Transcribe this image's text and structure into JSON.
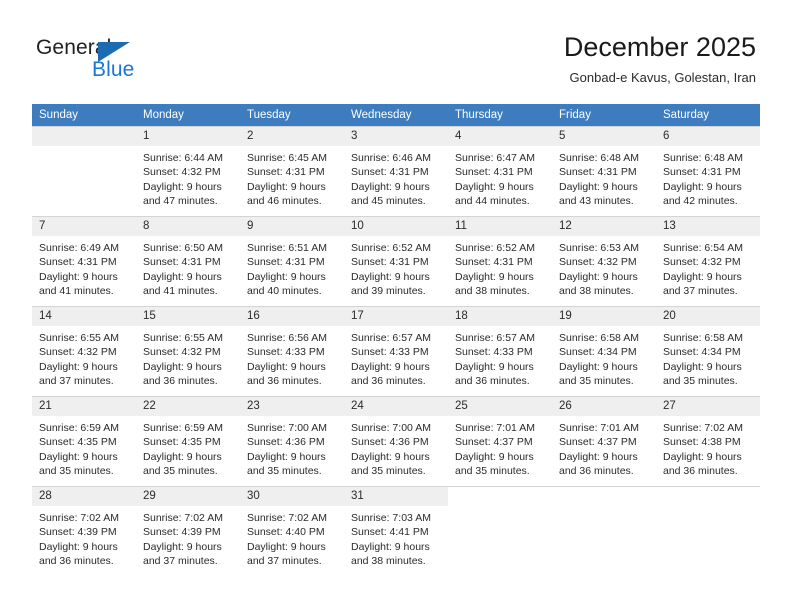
{
  "brand": {
    "name_part1": "General",
    "name_part2": "Blue",
    "triangle_icon": "triangle-icon",
    "accent_color": "#1b76d1",
    "triangle_color": "#1b6cb3"
  },
  "header": {
    "title": "December 2025",
    "location": "Gonbad-e Kavus, Golestan, Iran"
  },
  "theme": {
    "header_row_bg": "#3c7cbf",
    "day_number_bg": "#efefef",
    "grid_line": "#d4d4d4",
    "text": "#2b2b2b"
  },
  "weekdays": [
    "Sunday",
    "Monday",
    "Tuesday",
    "Wednesday",
    "Thursday",
    "Friday",
    "Saturday"
  ],
  "labels": {
    "sunrise_prefix": "Sunrise: ",
    "sunset_prefix": "Sunset: ",
    "daylight_prefix": "Daylight: "
  },
  "weeks": [
    [
      {
        "empty": true
      },
      {
        "day": "1",
        "sunrise": "Sunrise: 6:44 AM",
        "sunset": "Sunset: 4:32 PM",
        "daylight": "Daylight: 9 hours and 47 minutes."
      },
      {
        "day": "2",
        "sunrise": "Sunrise: 6:45 AM",
        "sunset": "Sunset: 4:31 PM",
        "daylight": "Daylight: 9 hours and 46 minutes."
      },
      {
        "day": "3",
        "sunrise": "Sunrise: 6:46 AM",
        "sunset": "Sunset: 4:31 PM",
        "daylight": "Daylight: 9 hours and 45 minutes."
      },
      {
        "day": "4",
        "sunrise": "Sunrise: 6:47 AM",
        "sunset": "Sunset: 4:31 PM",
        "daylight": "Daylight: 9 hours and 44 minutes."
      },
      {
        "day": "5",
        "sunrise": "Sunrise: 6:48 AM",
        "sunset": "Sunset: 4:31 PM",
        "daylight": "Daylight: 9 hours and 43 minutes."
      },
      {
        "day": "6",
        "sunrise": "Sunrise: 6:48 AM",
        "sunset": "Sunset: 4:31 PM",
        "daylight": "Daylight: 9 hours and 42 minutes."
      }
    ],
    [
      {
        "day": "7",
        "sunrise": "Sunrise: 6:49 AM",
        "sunset": "Sunset: 4:31 PM",
        "daylight": "Daylight: 9 hours and 41 minutes."
      },
      {
        "day": "8",
        "sunrise": "Sunrise: 6:50 AM",
        "sunset": "Sunset: 4:31 PM",
        "daylight": "Daylight: 9 hours and 41 minutes."
      },
      {
        "day": "9",
        "sunrise": "Sunrise: 6:51 AM",
        "sunset": "Sunset: 4:31 PM",
        "daylight": "Daylight: 9 hours and 40 minutes."
      },
      {
        "day": "10",
        "sunrise": "Sunrise: 6:52 AM",
        "sunset": "Sunset: 4:31 PM",
        "daylight": "Daylight: 9 hours and 39 minutes."
      },
      {
        "day": "11",
        "sunrise": "Sunrise: 6:52 AM",
        "sunset": "Sunset: 4:31 PM",
        "daylight": "Daylight: 9 hours and 38 minutes."
      },
      {
        "day": "12",
        "sunrise": "Sunrise: 6:53 AM",
        "sunset": "Sunset: 4:32 PM",
        "daylight": "Daylight: 9 hours and 38 minutes."
      },
      {
        "day": "13",
        "sunrise": "Sunrise: 6:54 AM",
        "sunset": "Sunset: 4:32 PM",
        "daylight": "Daylight: 9 hours and 37 minutes."
      }
    ],
    [
      {
        "day": "14",
        "sunrise": "Sunrise: 6:55 AM",
        "sunset": "Sunset: 4:32 PM",
        "daylight": "Daylight: 9 hours and 37 minutes."
      },
      {
        "day": "15",
        "sunrise": "Sunrise: 6:55 AM",
        "sunset": "Sunset: 4:32 PM",
        "daylight": "Daylight: 9 hours and 36 minutes."
      },
      {
        "day": "16",
        "sunrise": "Sunrise: 6:56 AM",
        "sunset": "Sunset: 4:33 PM",
        "daylight": "Daylight: 9 hours and 36 minutes."
      },
      {
        "day": "17",
        "sunrise": "Sunrise: 6:57 AM",
        "sunset": "Sunset: 4:33 PM",
        "daylight": "Daylight: 9 hours and 36 minutes."
      },
      {
        "day": "18",
        "sunrise": "Sunrise: 6:57 AM",
        "sunset": "Sunset: 4:33 PM",
        "daylight": "Daylight: 9 hours and 36 minutes."
      },
      {
        "day": "19",
        "sunrise": "Sunrise: 6:58 AM",
        "sunset": "Sunset: 4:34 PM",
        "daylight": "Daylight: 9 hours and 35 minutes."
      },
      {
        "day": "20",
        "sunrise": "Sunrise: 6:58 AM",
        "sunset": "Sunset: 4:34 PM",
        "daylight": "Daylight: 9 hours and 35 minutes."
      }
    ],
    [
      {
        "day": "21",
        "sunrise": "Sunrise: 6:59 AM",
        "sunset": "Sunset: 4:35 PM",
        "daylight": "Daylight: 9 hours and 35 minutes."
      },
      {
        "day": "22",
        "sunrise": "Sunrise: 6:59 AM",
        "sunset": "Sunset: 4:35 PM",
        "daylight": "Daylight: 9 hours and 35 minutes."
      },
      {
        "day": "23",
        "sunrise": "Sunrise: 7:00 AM",
        "sunset": "Sunset: 4:36 PM",
        "daylight": "Daylight: 9 hours and 35 minutes."
      },
      {
        "day": "24",
        "sunrise": "Sunrise: 7:00 AM",
        "sunset": "Sunset: 4:36 PM",
        "daylight": "Daylight: 9 hours and 35 minutes."
      },
      {
        "day": "25",
        "sunrise": "Sunrise: 7:01 AM",
        "sunset": "Sunset: 4:37 PM",
        "daylight": "Daylight: 9 hours and 35 minutes."
      },
      {
        "day": "26",
        "sunrise": "Sunrise: 7:01 AM",
        "sunset": "Sunset: 4:37 PM",
        "daylight": "Daylight: 9 hours and 36 minutes."
      },
      {
        "day": "27",
        "sunrise": "Sunrise: 7:02 AM",
        "sunset": "Sunset: 4:38 PM",
        "daylight": "Daylight: 9 hours and 36 minutes."
      }
    ],
    [
      {
        "day": "28",
        "sunrise": "Sunrise: 7:02 AM",
        "sunset": "Sunset: 4:39 PM",
        "daylight": "Daylight: 9 hours and 36 minutes."
      },
      {
        "day": "29",
        "sunrise": "Sunrise: 7:02 AM",
        "sunset": "Sunset: 4:39 PM",
        "daylight": "Daylight: 9 hours and 37 minutes."
      },
      {
        "day": "30",
        "sunrise": "Sunrise: 7:02 AM",
        "sunset": "Sunset: 4:40 PM",
        "daylight": "Daylight: 9 hours and 37 minutes."
      },
      {
        "day": "31",
        "sunrise": "Sunrise: 7:03 AM",
        "sunset": "Sunset: 4:41 PM",
        "daylight": "Daylight: 9 hours and 38 minutes."
      },
      {
        "blank": true
      },
      {
        "blank": true
      },
      {
        "blank": true
      }
    ]
  ]
}
